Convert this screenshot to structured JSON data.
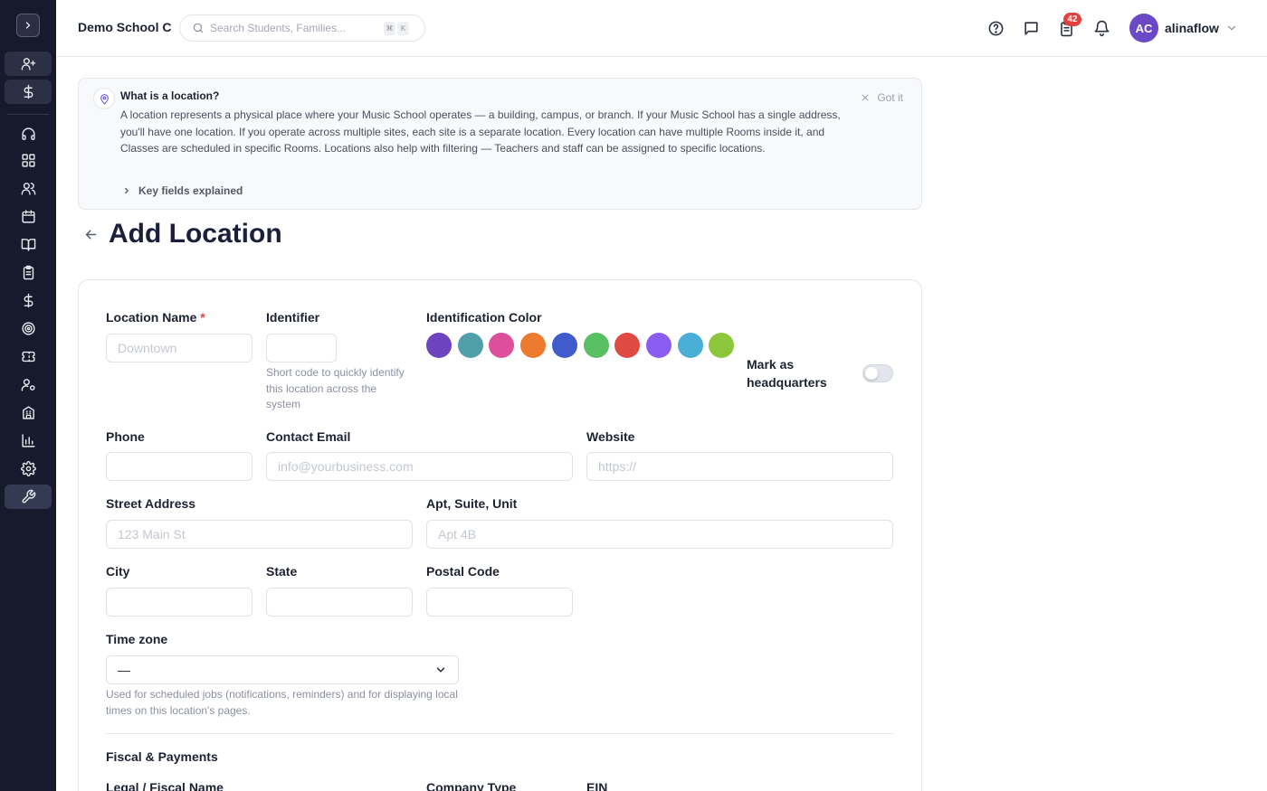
{
  "sidebar": {
    "items": [
      {
        "icon": "user-plus-icon"
      },
      {
        "icon": "dollar-icon"
      },
      {
        "icon": "headset-icon"
      },
      {
        "icon": "dashboard-grid-icon"
      },
      {
        "icon": "users-icon"
      },
      {
        "icon": "calendar-icon"
      },
      {
        "icon": "book-open-icon"
      },
      {
        "icon": "clipboard-icon"
      },
      {
        "icon": "dollar-icon"
      },
      {
        "icon": "target-icon"
      },
      {
        "icon": "ticket-icon"
      },
      {
        "icon": "user-settings-icon"
      },
      {
        "icon": "building-icon"
      },
      {
        "icon": "bar-chart-icon"
      },
      {
        "icon": "gear-icon"
      },
      {
        "icon": "wrench-icon"
      }
    ]
  },
  "header": {
    "school_name": "Demo School C",
    "search_placeholder": "Search Students, Families...",
    "shortcut_keys": [
      "⌘",
      "K"
    ],
    "notification_count": "42",
    "user_initials": "AC",
    "username": "alinaflow"
  },
  "info": {
    "title": "What is a location?",
    "body": "A location represents a physical place where your Music School operates — a building, campus, or branch. If your Music School has a single address, you'll have one location. If you operate across multiple sites, each site is a separate location. Every location can have multiple Rooms inside it, and Classes are scheduled in specific Rooms. Locations also help with filtering — Teachers and staff can be assigned to specific locations.",
    "dismiss_label": "Got it",
    "key_fields_label": "Key fields explained"
  },
  "page": {
    "title": "Add Location"
  },
  "form": {
    "location_name_label": "Location Name",
    "required_mark": "*",
    "location_name_placeholder": "Downtown",
    "identifier_label": "Identifier",
    "identifier_hint": "Short code to quickly identify this location across the system",
    "color_label": "Identification Color",
    "colors": [
      "#6e43c0",
      "#4fa0a8",
      "#de4f9b",
      "#ec7b30",
      "#3f5bcc",
      "#58c063",
      "#df4b43",
      "#8b5cf0",
      "#4aafd6",
      "#8cc63a"
    ],
    "headquarters_label": "Mark as headquarters",
    "headquarters_on": false,
    "phone_label": "Phone",
    "email_label": "Contact Email",
    "email_placeholder": "info@yourbusiness.com",
    "website_label": "Website",
    "website_placeholder": "https://",
    "street_label": "Street Address",
    "street_placeholder": "123 Main St",
    "apt_label": "Apt, Suite, Unit",
    "apt_placeholder": "Apt 4B",
    "city_label": "City",
    "state_label": "State",
    "postal_label": "Postal Code",
    "timezone_label": "Time zone",
    "timezone_value": "—",
    "timezone_hint": "Used for scheduled jobs (notifications, reminders) and for displaying local times on this location's pages.",
    "fiscal_section": "Fiscal & Payments",
    "legal_name_label": "Legal / Fiscal Name",
    "company_type_label": "Company Type",
    "ein_label": "EIN"
  }
}
